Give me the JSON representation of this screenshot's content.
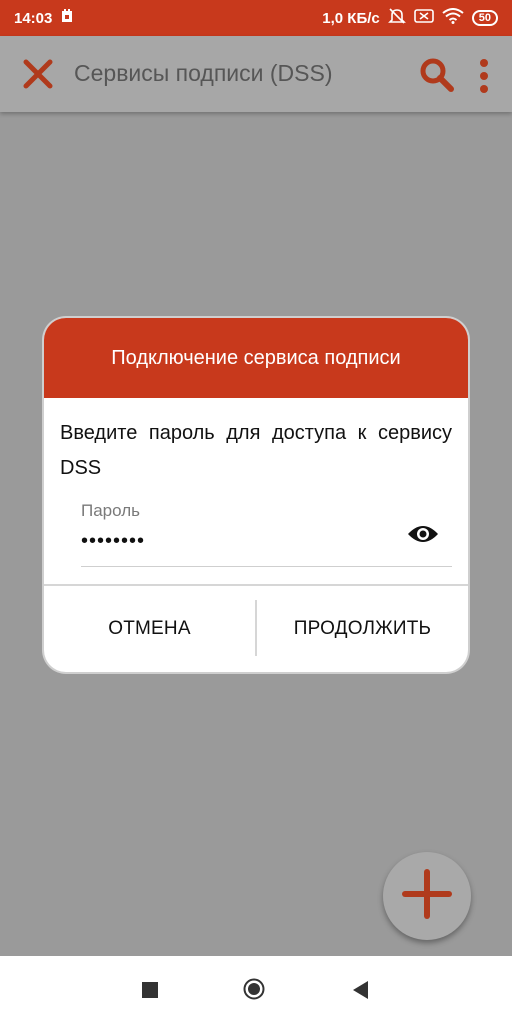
{
  "status_bar": {
    "time": "14:03",
    "network_speed": "1,0 КБ/с",
    "battery": "50",
    "icons": [
      "notification-icon",
      "mute-icon",
      "sim-icon",
      "wifi-icon",
      "battery-icon"
    ]
  },
  "app_bar": {
    "title": "Сервисы подписи (DSS)",
    "icons": [
      "close-icon",
      "search-icon",
      "more-vert-icon"
    ]
  },
  "dialog": {
    "title": "Подключение сервиса подписи",
    "message": "Введите пароль для доступа к сервису DSS",
    "password_label": "Пароль",
    "password_value": "••••••••",
    "cancel_label": "ОТМЕНА",
    "continue_label": "ПРОДОЛЖИТЬ"
  },
  "colors": {
    "accent": "#c8391c",
    "overlay": "#9a9a9a"
  },
  "fab": {
    "icon": "plus-icon"
  },
  "nav_bar": {
    "icons": [
      "recents-icon",
      "home-icon",
      "back-icon"
    ]
  }
}
